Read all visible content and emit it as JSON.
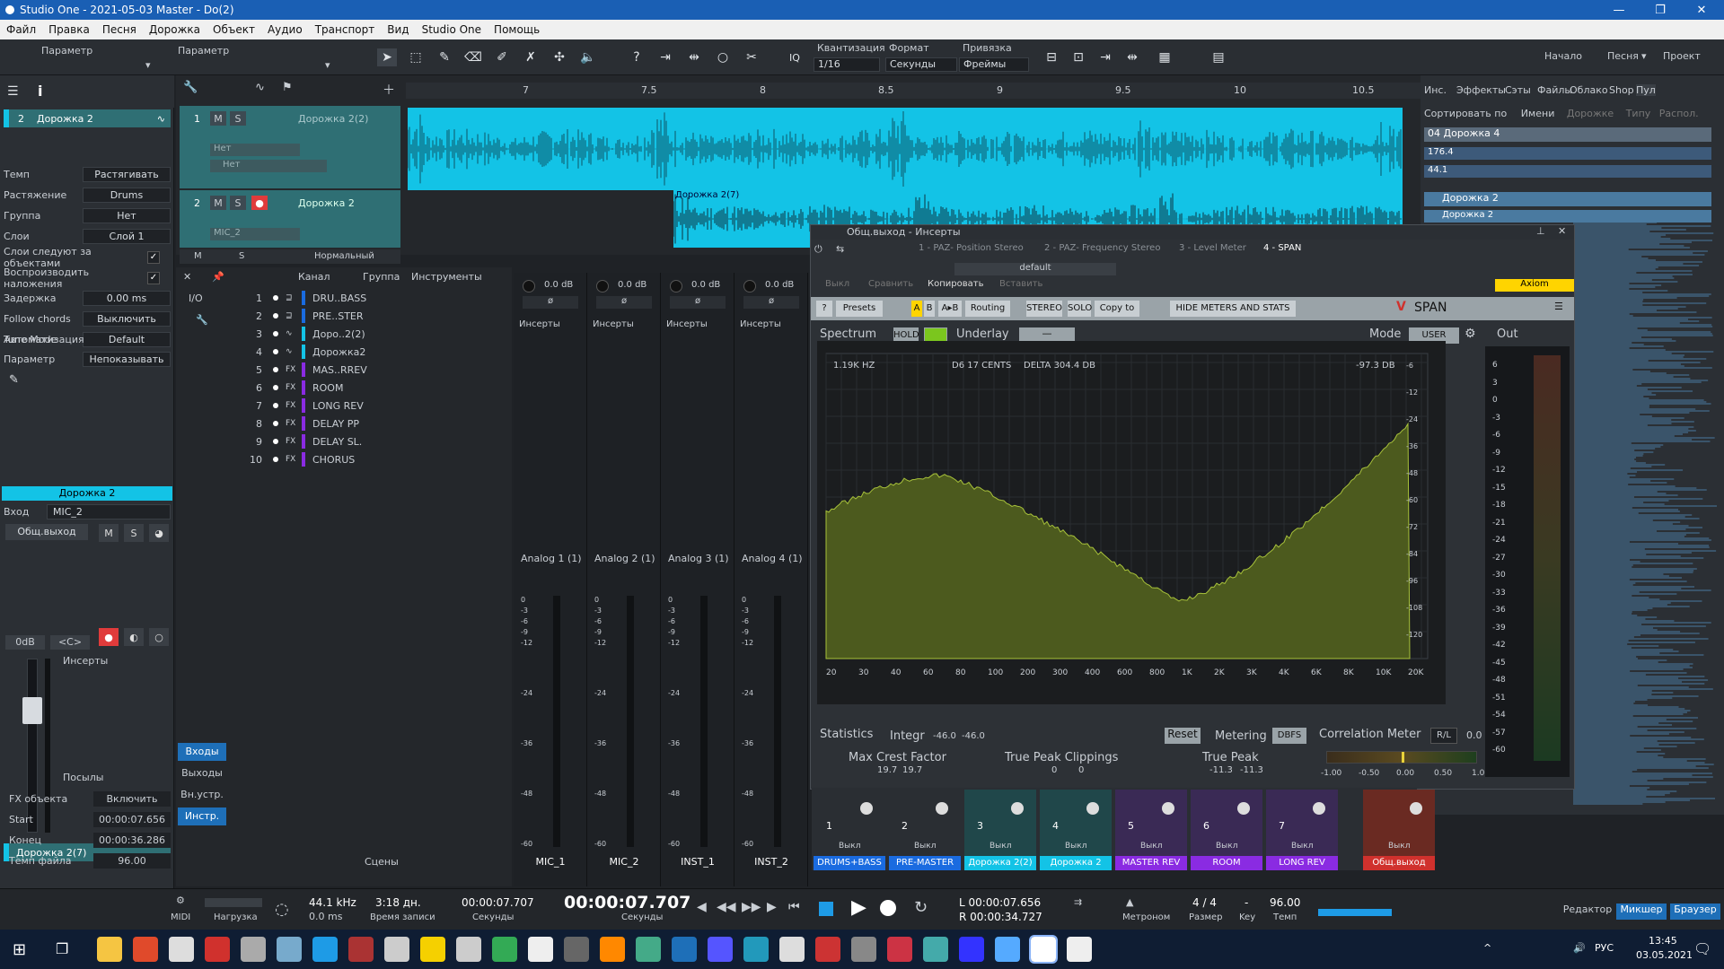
{
  "window": {
    "title": "Studio One - 2021-05-03 Master - Do(2)"
  },
  "menu": [
    "Файл",
    "Правка",
    "Песня",
    "Дорожка",
    "Объект",
    "Аудио",
    "Транспорт",
    "Вид",
    "Studio One",
    "Помощь"
  ],
  "toolbar": {
    "param1": "Параметр",
    "param2": "Параметр",
    "quant_label": "Квантизация",
    "quant_value": "1/16",
    "format_label": "Формат",
    "format_value": "Секунды",
    "snap_label": "Привязка",
    "snap_value": "Фреймы",
    "iq": "IQ",
    "right": [
      "Начало",
      "Песня",
      "Проект"
    ]
  },
  "inspector": {
    "track_num": "2",
    "track_name": "Дорожка 2",
    "rows": [
      {
        "label": "Темп",
        "value": "Растягивать"
      },
      {
        "label": "Растяжение",
        "value": "Drums"
      },
      {
        "label": "Группа",
        "value": "Нет"
      },
      {
        "label": "Слои",
        "value": "Слой 1"
      },
      {
        "label": "Слои следуют за объектами",
        "value": ""
      },
      {
        "label": "Воспроизводить наложения",
        "value": ""
      },
      {
        "label": "Задержка",
        "value": "0.00 ms"
      },
      {
        "label": "Follow chords",
        "value": "Выключить"
      },
      {
        "label": "Tune Mode",
        "value": "Default"
      }
    ],
    "automation_label": "Автоматизация",
    "param_label": "Параметр",
    "param_value": "Непоказывать",
    "channel_title": "Дорожка 2",
    "input_label": "Вход",
    "input_value": "MIC_2",
    "output_value": "Общ.выход",
    "gain": "0dB",
    "pan": "<C>",
    "inserts": "Инсерты",
    "sends": "Посылы",
    "event_title": "Дорожка 2(7)",
    "event_rows": [
      {
        "label": "FX объекта",
        "value": "Включить"
      },
      {
        "label": "Start",
        "value": "00:00:07.656"
      },
      {
        "label": "Конец",
        "value": "00:00:36.286"
      },
      {
        "label": "Темп файла",
        "value": "96.00"
      }
    ]
  },
  "ruler": [
    "7",
    "7.5",
    "8",
    "8.5",
    "9",
    "9.5",
    "10",
    "10.5"
  ],
  "tracks": [
    {
      "num": "1",
      "name": "Дорожка 2(2)",
      "combo1": "Нет",
      "combo2": "Нет"
    },
    {
      "num": "2",
      "name": "Дорожка 2",
      "combo1": "MIC_2",
      "event": "Дорожка 2(7)"
    }
  ],
  "track_footer": {
    "m": "M",
    "s": "S",
    "mode": "Нормальный"
  },
  "channel_list": {
    "headers": [
      "Канал",
      "Группа",
      "Инструменты"
    ],
    "io": "I/O",
    "rows": [
      {
        "n": "1",
        "t": "⊒",
        "name": "DRU..BASS",
        "c": "#1a6be0"
      },
      {
        "n": "2",
        "t": "⊒",
        "name": "PRE..STER",
        "c": "#1a6be0"
      },
      {
        "n": "3",
        "t": "∿",
        "name": "Доро..2(2)",
        "c": "#13c3e6"
      },
      {
        "n": "4",
        "t": "∿",
        "name": "Дорожка2",
        "c": "#13c3e6"
      },
      {
        "n": "5",
        "t": "FX",
        "name": "MAS..RREV",
        "c": "#8a2be2"
      },
      {
        "n": "6",
        "t": "FX",
        "name": "ROOM",
        "c": "#8a2be2"
      },
      {
        "n": "7",
        "t": "FX",
        "name": "LONG REV",
        "c": "#8a2be2"
      },
      {
        "n": "8",
        "t": "FX",
        "name": "DELAY PP",
        "c": "#8a2be2"
      },
      {
        "n": "9",
        "t": "FX",
        "name": "DELAY SL.",
        "c": "#8a2be2"
      },
      {
        "n": "10",
        "t": "FX",
        "name": "CHORUS",
        "c": "#8a2be2"
      }
    ],
    "side_buttons": [
      "Входы",
      "Выходы",
      "Вн.устр.",
      "Инстр."
    ],
    "scenes": "Сцены"
  },
  "input_strips": [
    {
      "db": "0.0 dB",
      "inserts": "Инсерты",
      "name": "Analog 1 (1)",
      "label": "MIC_1"
    },
    {
      "db": "0.0 dB",
      "inserts": "Инсерты",
      "name": "Analog 2 (1)",
      "label": "MIC_2"
    },
    {
      "db": "0.0 dB",
      "inserts": "Инсерты",
      "name": "Analog 3 (1)",
      "label": "INST_1"
    },
    {
      "db": "0.0 dB",
      "inserts": "Инсерты",
      "name": "Analog 4 (1)",
      "label": "INST_2"
    }
  ],
  "strip_scale": [
    "0",
    "-3",
    "-6",
    "-9",
    "-12",
    "-24",
    "-36",
    "-48",
    "-60"
  ],
  "plugin": {
    "header": "Общ.выход - Инсерты",
    "tabs": [
      "1 - PAZ- Position Stereo",
      "2 - PAZ- Frequency Stereo",
      "3 - Level Meter",
      "4 - SPAN"
    ],
    "preset": "default",
    "off": "Выкл",
    "compare": "Сравнить",
    "copy": "Копировать",
    "paste": "Вставить",
    "axiom": "Axiom",
    "span_buttons": [
      "?",
      "Presets",
      "A",
      "B",
      "A▸B",
      "Routing",
      "STEREO",
      "SOLO",
      "Copy to",
      "HIDE METERS AND STATS"
    ],
    "brand": "SPAN",
    "spectrum": "Spectrum",
    "hold": "HOLD",
    "underlay": "Underlay",
    "underlay_val": "—",
    "mode": "Mode",
    "mode_val": "USER",
    "out": "Out",
    "readout_freq": "1.19K HZ",
    "readout_note": "D6  17 CENTS",
    "readout_delta": "DELTA 304.4 DB",
    "readout_db": "-97.3 DB",
    "freq_ticks": [
      "20",
      "30",
      "40",
      "60",
      "80",
      "100",
      "200",
      "300",
      "400",
      "600",
      "800",
      "1K",
      "2K",
      "3K",
      "4K",
      "6K",
      "8K",
      "10K",
      "20K"
    ],
    "db_ticks": [
      "-6",
      "-12",
      "-24",
      "-36",
      "-48",
      "-60",
      "-72",
      "-84",
      "-96",
      "-108",
      "-120"
    ],
    "out_ticks": [
      "6",
      "3",
      "0",
      "-3",
      "-6",
      "-9",
      "-12",
      "-15",
      "-18",
      "-21",
      "-24",
      "-27",
      "-30",
      "-33",
      "-36",
      "-39",
      "-42",
      "-45",
      "-48",
      "-51",
      "-54",
      "-57",
      "-60"
    ],
    "stats": "Statistics",
    "integr": "Integr",
    "integr_l": "-46.0",
    "integr_r": "-46.0",
    "reset": "Reset",
    "metering": "Metering",
    "metering_val": "DBFS",
    "corr": "Correlation Meter",
    "corr_mode": "R/L",
    "corr_val": "0.0",
    "crest": "Max Crest Factor",
    "crest_l": "19.7",
    "crest_r": "19.7",
    "clip": "True Peak Clippings",
    "clip_l": "0",
    "clip_r": "0",
    "tpeak": "True Peak",
    "tpeak_l": "-11.3",
    "tpeak_r": "-11.3",
    "corr_ticks": [
      "-1.00",
      "-0.50",
      "0.00",
      "0.50",
      "1.00"
    ]
  },
  "bus_strips": [
    {
      "n": "1",
      "name": "DRUMS+BASS",
      "c": "#1a6be0",
      "off": "Выкл"
    },
    {
      "n": "2",
      "name": "PRE-MASTER",
      "c": "#1a6be0",
      "off": "Выкл"
    },
    {
      "n": "3",
      "name": "Дорожка 2(2)",
      "c": "#13c3e6",
      "off": "Выкл"
    },
    {
      "n": "4",
      "name": "Дорожка 2",
      "c": "#13c3e6",
      "off": "Выкл"
    },
    {
      "n": "5",
      "name": "MASTER REV",
      "c": "#8a2be2",
      "off": "Выкл"
    },
    {
      "n": "6",
      "name": "ROOM",
      "c": "#8a2be2",
      "off": "Выкл"
    },
    {
      "n": "7",
      "name": "LONG REV",
      "c": "#8a2be2",
      "off": "Выкл"
    },
    {
      "n": "",
      "name": "Общ.выход",
      "c": "#d0312d",
      "off": "Выкл"
    }
  ],
  "browser": {
    "tabs": [
      "Инс.",
      "Эффекты",
      "Сэты",
      "Файлы",
      "Облако",
      "Shop",
      "Пул"
    ],
    "sort": "Сортировать по",
    "sort_opts": [
      "Имени",
      "Дорожке",
      "Типу",
      "Распол."
    ],
    "rows": [
      "04 Дорожка 4",
      "176.4",
      "44.1",
      "Дорожка 2",
      "Дорожка 2"
    ]
  },
  "transport": {
    "midi": "MIDI",
    "load": "Нагрузка",
    "rate": "44.1 kHz",
    "latency": "0.0 ms",
    "rec_time": "3:18 дн.",
    "rec_label": "Время записи",
    "pos_sec": "00:00:07.707",
    "pos_sec_label": "Секунды",
    "pos_big": "00:00:07.707",
    "pos_big_label": "Секунды",
    "loop_l": "00:00:07.656",
    "loop_r": "00:00:34.727",
    "metronome": "Метроном",
    "sig": "4 / 4",
    "sig_label": "Размер",
    "key": "-",
    "key_label": "Key",
    "tempo": "96.00",
    "tempo_label": "Темп",
    "views": [
      "Редактор",
      "Микшер",
      "Браузер"
    ]
  },
  "taskbar": {
    "lang": "РУС",
    "time": "13:45",
    "date": "03.05.2021"
  }
}
